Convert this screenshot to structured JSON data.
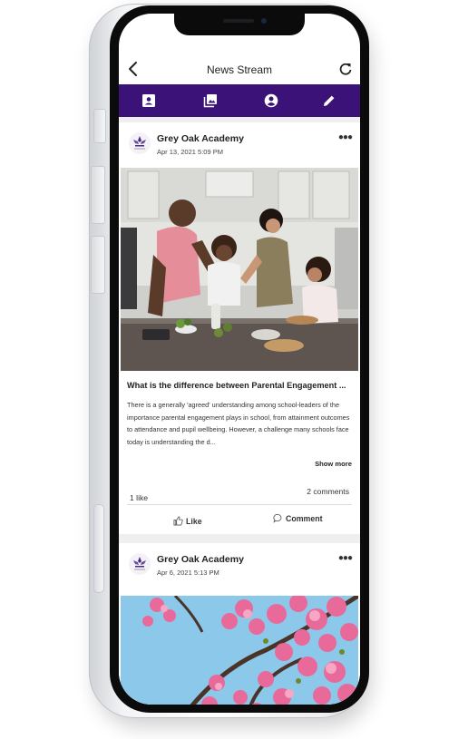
{
  "header": {
    "title": "News Stream",
    "back_icon": "chevron-left-icon",
    "refresh_icon": "refresh-icon"
  },
  "tabs": [
    {
      "icon": "contacts-icon"
    },
    {
      "icon": "photo-gallery-icon"
    },
    {
      "icon": "account-icon"
    },
    {
      "icon": "pencil-icon"
    }
  ],
  "colors": {
    "tabbar": "#3a1278",
    "frame": "#0b0b0c"
  },
  "posts": [
    {
      "author": "Grey Oak Academy",
      "date": "Apr 13, 2021 5:09 PM",
      "image": "family-cooking-photo",
      "title": "What is the difference between Parental Engagement ...",
      "excerpt": "There is a generally 'agreed' understanding among school-leaders of the importance parental engagement plays in school, from attainment outcomes to attendance and pupil wellbeing. However, a challenge many schools face today is understanding the d...",
      "show_more": "Show more",
      "likes": "1 like",
      "comments": "2 comments",
      "like_label": "Like",
      "comment_label": "Comment"
    },
    {
      "author": "Grey Oak Academy",
      "date": "Apr 6, 2021 5:13 PM",
      "image": "cherry-blossom-photo"
    }
  ]
}
